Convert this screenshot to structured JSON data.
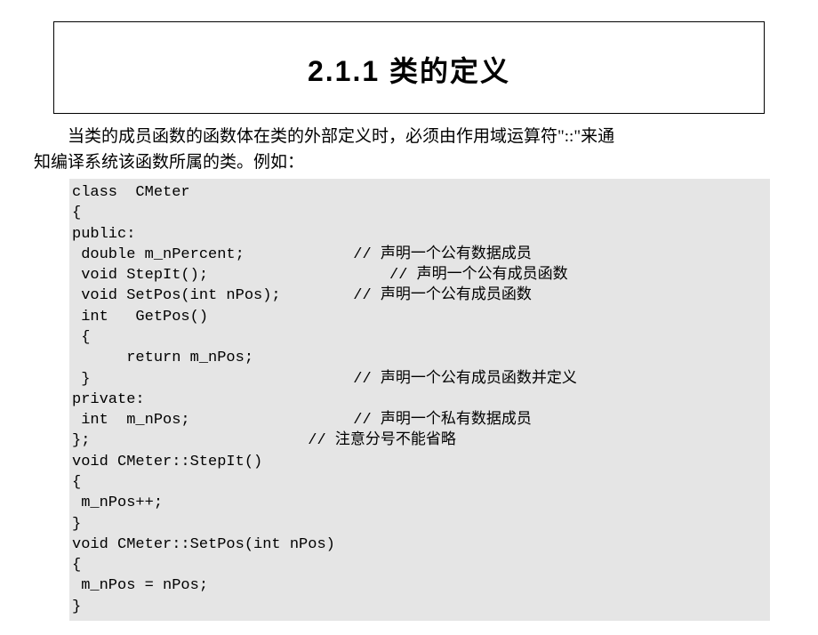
{
  "title": "2.1.1  类的定义",
  "intro_line1": "当类的成员函数的函数体在类的外部定义时，必须由作用域运算符\"::\"来通",
  "intro_line2": "知编译系统该函数所属的类。例如：",
  "code": [
    "class  CMeter",
    "{",
    "public:",
    " double m_nPercent;            // 声明一个公有数据成员",
    " void StepIt();                    // 声明一个公有成员函数",
    " void SetPos(int nPos);        // 声明一个公有成员函数",
    " int   GetPos()",
    " {",
    "      return m_nPos;",
    " }                             // 声明一个公有成员函数并定义",
    "private:",
    " int  m_nPos;                  // 声明一个私有数据成员",
    "};                        // 注意分号不能省略",
    "void CMeter::StepIt()",
    "{",
    " m_nPos++;",
    "}",
    "void CMeter::SetPos(int nPos)",
    "{",
    " m_nPos = nPos;",
    "}"
  ]
}
